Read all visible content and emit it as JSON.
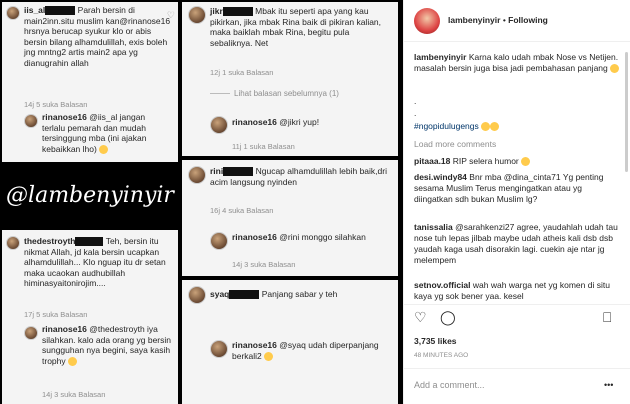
{
  "watermark": "@lambenyinyir",
  "c1": {
    "user": "iis_al",
    "text": "Parah bersin di main2inn.situ muslim kan@rinanose16 hrsnya berucap syukur klo or abis bersin bilang alhamdulillah, exis boleh  jng mntng2 artis main2 apa yg dianugrahin allah",
    "meta": "14j   5 suka   Balasan",
    "ruser": "rinanose16",
    "rtext": "@iis_al jangan terlalu pemarah dan mudah tersinggung mba (ini ajakan kebaikkan lho)",
    "rmeta": "14j   5 suka   Balasan"
  },
  "c2": {
    "user": "jikr",
    "text": "Mbak itu seperti apa yang kau pikirkan, jika mbak Rina baik di pikiran kalian, maka baiklah mbak Rina, begitu pula sebaliknya. Net",
    "meta": "12j   1 suka   Balasan",
    "more": "Lihat balasan sebelumnya (1)",
    "ruser": "rinanose16",
    "rtext": "@jikri yup!",
    "rmeta": "11j   1 suka   Balasan"
  },
  "c3": {
    "user": "rini",
    "text": "Ngucap alhamdulillah lebih baik,dri acim langsung nyinden",
    "meta": "16j   4 suka   Balasan",
    "ruser": "rinanose16",
    "rtext": "@rini monggo silahkan",
    "rmeta": "14j   3 suka   Balasan"
  },
  "c4": {
    "user": "thedestroyth",
    "text": "Teh, bersin itu nikmat Allah, jd kala bersin ucapkan alhamdulillah... Klo nguap itu dr setan maka ucaokan audhubillah himinasyaitonirojim....",
    "meta": "17j   5 suka   Balasan",
    "ruser": "rinanose16",
    "rtext": "@thedestroyth iya silahkan.  kalo ada orang yg bersin sungguhan nya begini, saya kasih trophy",
    "rmeta": "14j   3 suka   Balasan"
  },
  "c5": {
    "user": "syaq",
    "text": "Panjang sabar y teh",
    "meta": "",
    "ruser": "rinanose16",
    "rtext": "@syaq udah diperpanjang berkali2",
    "rmeta": ""
  },
  "panel": {
    "username": "lambenyinyir",
    "follow": "Following",
    "dot": "•",
    "caption_user": "lambenyinyir",
    "caption": "Karna kalo udah mbak Nose vs Netijen. masalah bersin juga bisa jadi pembahasan panjang",
    "dots": [
      ".",
      "."
    ],
    "hashtag": "#ngopidulugengs",
    "load_more": "Load more comments",
    "comments": [
      {
        "user": "pitaaa.18",
        "text": "RIP selera humor"
      },
      {
        "user": "desi.windy84",
        "text": "Bnr mba @dina_cinta71 Yg penting sesama Muslim Terus mengingatkan atau yg diingatkan sdh bukan Muslim lg?"
      },
      {
        "user": "tanissalia",
        "text": "@sarahkenzi27 agree, yaudahlah udah tau nose tuh lepas jilbab maybe udah atheis kali dsb dsb yaudah kaga usah disorakin lagi. cuekin aje ntar jg melempem"
      },
      {
        "user": "setnov.official",
        "text": "wah wah warga net yg komen di situ kaya yg sok bener yaa. kesel"
      }
    ],
    "likes": "3,735 likes",
    "time": "48 MINUTES AGO",
    "add_comment": "Add a comment...",
    "more_icon": "•••"
  }
}
